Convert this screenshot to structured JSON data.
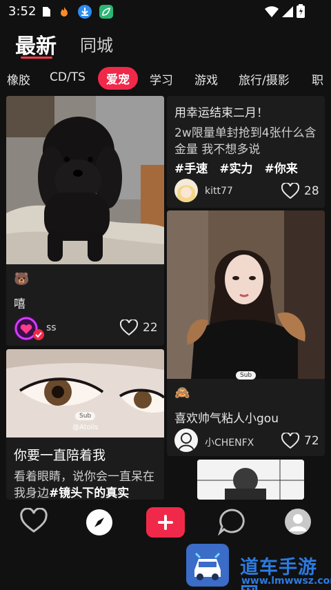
{
  "status_bar": {
    "time": "3:52"
  },
  "main_tabs": {
    "latest": "最新",
    "same_city": "同城"
  },
  "categories": [
    "橡胶",
    "CD/TS",
    "爱宠",
    "学习",
    "游戏",
    "旅行/摄影",
    "职"
  ],
  "cards": {
    "poodle": {
      "emoji": "🐻",
      "text": "嘻",
      "author": "ss",
      "likes": "22"
    },
    "text_post": {
      "title": "用幸运结束二月！",
      "body": "2w限量单封抢到4张什么含金量 我不想多说",
      "tags": "#手速　#实力　#你来",
      "author": "kitt77",
      "likes": "28"
    },
    "girl": {
      "sub_badge": "Sub",
      "emoji": "🙈",
      "text": "喜欢帅气粘人小gou",
      "author": "小CHENFX",
      "likes": "72"
    },
    "eye": {
      "sub_badge": "Sub",
      "handle": "@Atolis",
      "title": "你要一直陪着我",
      "body_plain": "看着眼睛，说你会一直呆在我身边",
      "body_tag": "#镜头下的真实"
    }
  },
  "watermark": {
    "title": "道车手游网",
    "url": "www.lmwwsz.com"
  },
  "colors": {
    "accent": "#f0294a",
    "background": "#111111",
    "card": "#1c1c1c"
  }
}
